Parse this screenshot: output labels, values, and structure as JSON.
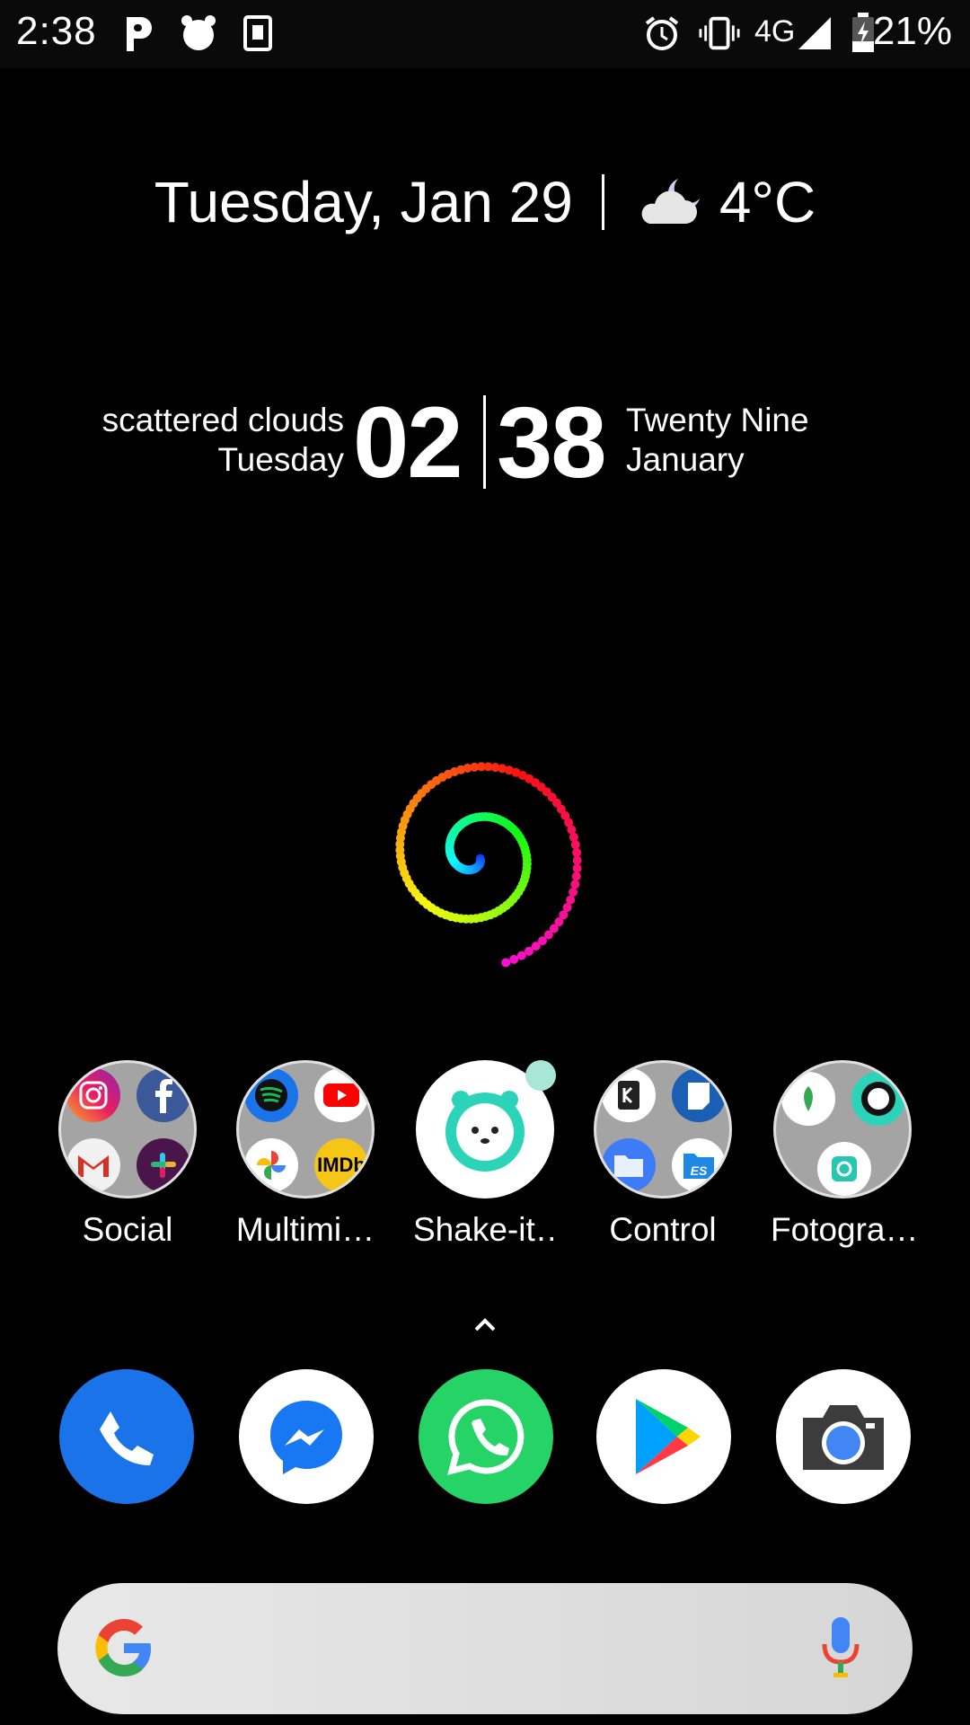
{
  "status_bar": {
    "time": "2:38",
    "left_icons": [
      "p-icon",
      "alarm-clock-icon",
      "k-badge-icon"
    ],
    "right_icons": [
      "alarm-icon",
      "vibrate-icon",
      "signal-icon",
      "battery-charging-icon"
    ],
    "network": "4G",
    "battery": "21%"
  },
  "date_widget": {
    "date": "Tuesday, Jan 29",
    "weather_icon": "cloud-moon-icon",
    "temperature": "4°C"
  },
  "clock_widget": {
    "condition": "scattered clouds",
    "weekday": "Tuesday",
    "hour": "02",
    "minute": "38",
    "day_words": "Twenty Nine",
    "month": "January"
  },
  "apps": [
    {
      "label": "Social",
      "type": "folder"
    },
    {
      "label": "Multimi…",
      "type": "folder"
    },
    {
      "label": "Shake-it…",
      "type": "app"
    },
    {
      "label": "Control",
      "type": "folder"
    },
    {
      "label": "Fotogra…",
      "type": "folder"
    }
  ],
  "folder_contents": {
    "social": [
      "instagram-icon",
      "facebook-icon",
      "gmail-icon",
      "slack-icon"
    ],
    "multimedia": [
      "spotify-icon",
      "youtube-icon",
      "google-photos-icon",
      "imdb-icon"
    ],
    "control": [
      "kwgt-icon",
      "notes-icon",
      "files-icon",
      "es-file-icon"
    ],
    "fotografia": [
      "snapseed-icon",
      "lens-icon",
      "photo-editor-icon"
    ]
  },
  "imdb_text": "IMDb",
  "dock": [
    "phone-icon",
    "messenger-icon",
    "whatsapp-icon",
    "play-store-icon",
    "camera-icon"
  ],
  "colors": {
    "phone": "#1a73e8",
    "whatsapp": "#25d366",
    "messenger": "#1877f2",
    "shake_teal": "#2bd4b8"
  }
}
